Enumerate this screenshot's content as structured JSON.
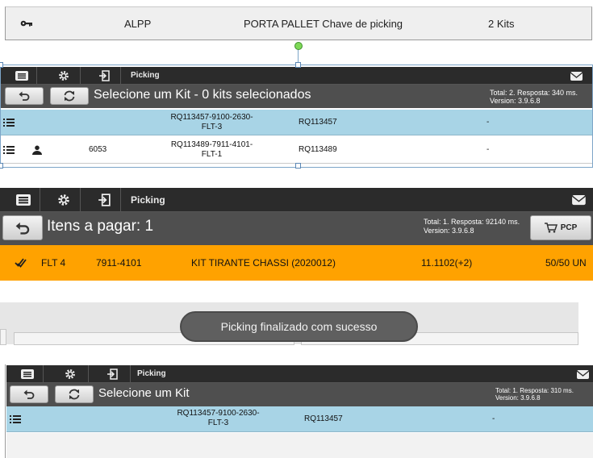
{
  "pallet_row": {
    "icon": "key-icon",
    "code": "ALPP",
    "description": "PORTA PALLET Chave de picking",
    "quantity": "2 Kits"
  },
  "picking_screen_1": {
    "app_title": "Picking",
    "toolbar_icons": [
      "list-icon",
      "settings-icon",
      "logout-icon",
      "mail-icon"
    ],
    "heading": "Selecione um Kit - 0 kits selecionados",
    "meta_total": "Total: 2. Resposta: 340 ms.",
    "meta_version": "Version: 3.9.6.8",
    "rows": [
      {
        "id_line1": "RQ113457-9100-2630-",
        "id_line2": "FLT-3",
        "req": "RQ113457",
        "status": "-",
        "number": "",
        "has_user": false
      },
      {
        "id_line1": "RQ113489-7911-4101-",
        "id_line2": "FLT-1",
        "req": "RQ113489",
        "status": "-",
        "number": "6053",
        "has_user": true
      }
    ],
    "colors": {
      "selected_row": "#a8d4e6",
      "toolbar": "#2b2b2b",
      "subbar": "#4f4f4f"
    }
  },
  "picking_screen_2": {
    "app_title": "Picking",
    "heading": "Itens a pagar: 1",
    "meta_total": "Total: 1. Resposta: 92140 ms.",
    "meta_version": "Version: 3.9.6.8",
    "pcp_label": "PCP",
    "item": {
      "location": "FLT 4",
      "code": "7911-4101",
      "description": "KIT TIRANTE CHASSI (2020012)",
      "position": "11.1102(+2)",
      "quantity": "50/50 UN"
    },
    "colors": {
      "item_row": "#ffa200"
    }
  },
  "toast": {
    "message": "Picking finalizado com sucesso"
  },
  "picking_screen_3": {
    "app_title": "Picking",
    "heading": "Selecione um Kit",
    "meta_total": "Total: 1. Resposta: 310 ms.",
    "meta_version": "Version: 3.9.6.8",
    "rows": [
      {
        "id_line1": "RQ113457-9100-2630-",
        "id_line2": "FLT-3",
        "req": "RQ113457",
        "status": "-"
      }
    ]
  }
}
